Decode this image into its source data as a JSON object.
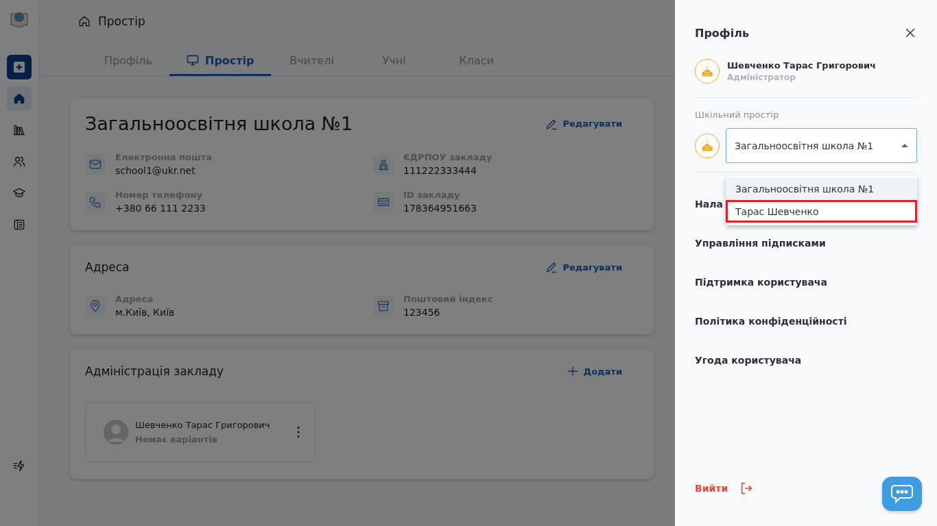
{
  "sidebar": {
    "items": [
      {
        "kind": "home",
        "selected": true
      },
      {
        "kind": "library",
        "selected": false
      },
      {
        "kind": "people",
        "selected": false
      },
      {
        "kind": "cap",
        "selected": false
      },
      {
        "kind": "book",
        "selected": false
      },
      {
        "kind": "bolt",
        "selected": false
      }
    ]
  },
  "breadcrumb": {
    "title": "Простір"
  },
  "tabs": [
    {
      "label": "Профіль",
      "selected": false
    },
    {
      "label": "Простір",
      "selected": true
    },
    {
      "label": "Вчителі",
      "selected": false
    },
    {
      "label": "Учні",
      "selected": false
    },
    {
      "label": "Класи",
      "selected": false
    }
  ],
  "school_card": {
    "title": "Загальноосвітня школа №1",
    "action": "Редагувати",
    "fields": [
      {
        "kind": "email",
        "label": "Електронна пошта",
        "value": "school1@ukr.net"
      },
      {
        "kind": "building",
        "label": "ЄДРПОУ закладу",
        "value": "111222333444"
      },
      {
        "kind": "phone",
        "label": "Номер телефону",
        "value": "+380 66 111 2233"
      },
      {
        "kind": "card",
        "label": "ID закладу",
        "value": "178364951663"
      }
    ]
  },
  "address_card": {
    "title": "Адреса",
    "action": "Редагувати",
    "fields": [
      {
        "kind": "pin",
        "label": "Адреса",
        "value": "м.Київ, Київ"
      },
      {
        "kind": "archive",
        "label": "Поштовий індекс",
        "value": "123456"
      }
    ]
  },
  "admin_card": {
    "title": "Адміністрація закладу",
    "action": "Додати",
    "members": [
      {
        "name": "Шевченко Тарас Григорович",
        "subtitle": "Немає варіантів"
      }
    ]
  },
  "drawer": {
    "title": "Профіль",
    "user": {
      "name": "Шевченко Тарас Григорович",
      "role": "Адміністратор"
    },
    "section_label": "Шкільний простір",
    "select": {
      "value": "Загальноосвітня школа №1",
      "expanded": true,
      "options": [
        {
          "label": "Загальноосвітня школа №1",
          "selected": true,
          "highlighted": false
        },
        {
          "label": "Тарас Шевченко",
          "selected": false,
          "highlighted": true
        }
      ]
    },
    "menu": [
      "Нала",
      "Управління підписками",
      "Підтримка користувача",
      "Політика конфіденційності",
      "Угода користувача"
    ],
    "logout": "Вийти"
  }
}
